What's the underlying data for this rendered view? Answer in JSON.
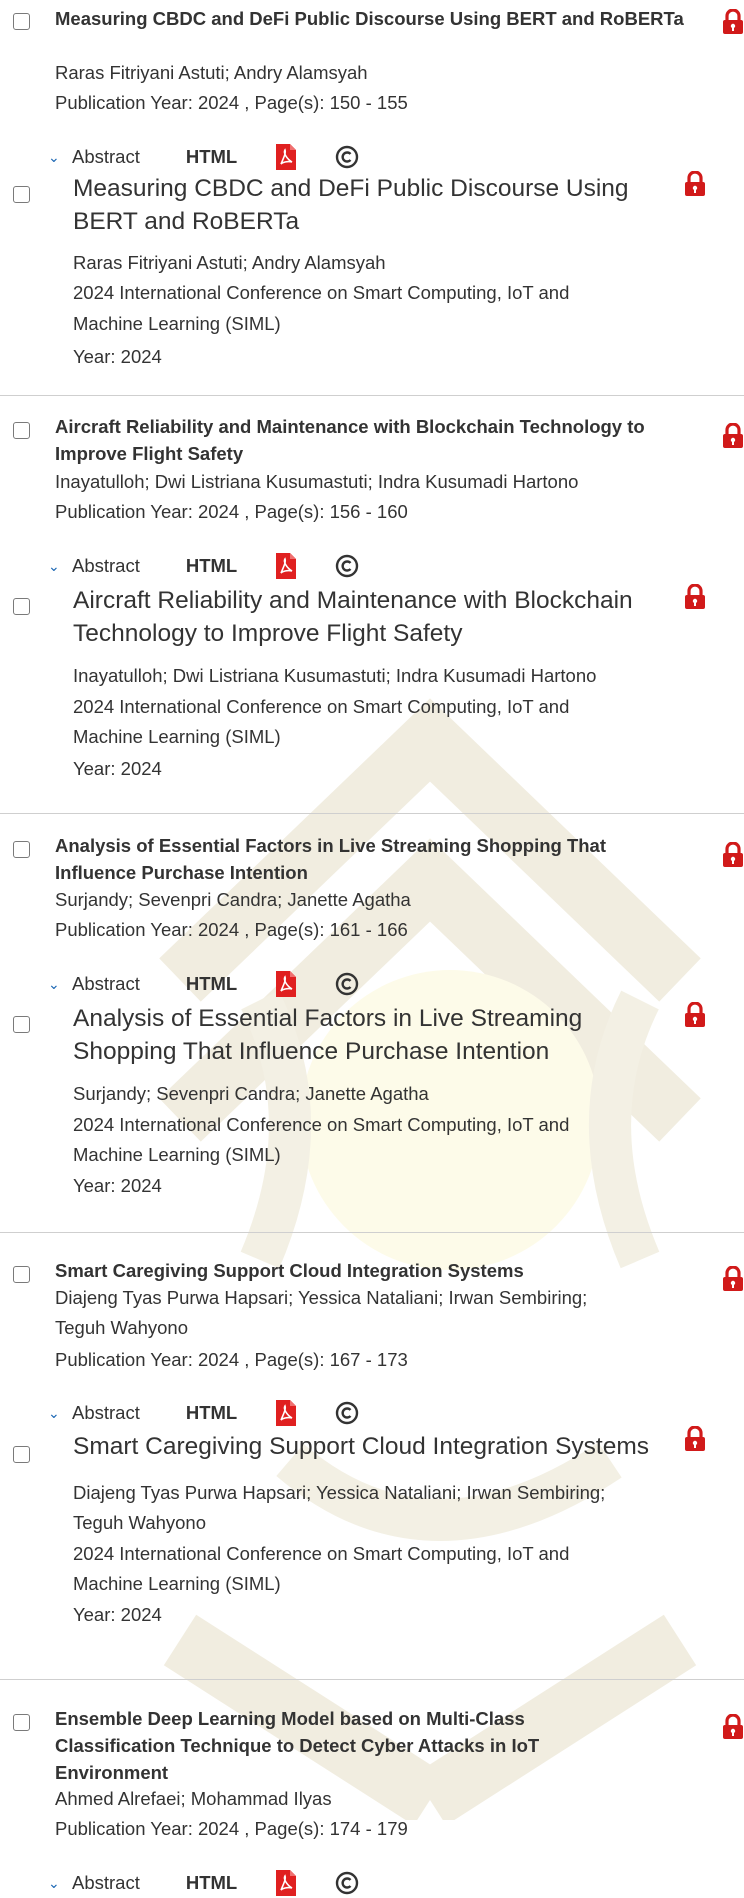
{
  "colors": {
    "lock": "#d11a1a",
    "pdf": "#e02020",
    "link": "#1a66b3",
    "divider": "#cfcfcf"
  },
  "icons": {
    "lock": "lock-icon",
    "pdf": "pdf-icon",
    "copyright": "copyright-icon",
    "chevron": "chevron-down-icon"
  },
  "labels": {
    "abstract": "Abstract",
    "html": "HTML"
  },
  "items": [
    {
      "header": {
        "title": "Measuring CBDC and DeFi Public Discourse Using BERT and RoBERTa",
        "authors": "Raras Fitriyani Astuti; Andry Alamsyah",
        "pubinfo": "Publication Year: 2024 , Page(s): 150  -  155"
      },
      "detail": {
        "title": "Measuring CBDC and DeFi Public Discourse Using BERT and RoBERTa",
        "authors": "Raras Fitriyani Astuti; Andry Alamsyah",
        "conf1": "2024 International Conference on Smart Computing, IoT and",
        "conf2": "Machine Learning (SIML)",
        "year": "Year: 2024"
      }
    },
    {
      "header": {
        "title": "Aircraft Reliability and Maintenance with Blockchain Technology to Improve Flight Safety",
        "authors": "Inayatulloh; Dwi Listriana Kusumastuti; Indra Kusumadi Hartono",
        "pubinfo": "Publication Year: 2024 , Page(s): 156  -  160"
      },
      "detail": {
        "title": "Aircraft Reliability and Maintenance with Blockchain Technology to Improve Flight Safety",
        "authors": "Inayatulloh; Dwi Listriana Kusumastuti; Indra Kusumadi Hartono",
        "conf1": "2024 International Conference on Smart Computing, IoT and",
        "conf2": "Machine Learning (SIML)",
        "year": "Year: 2024"
      }
    },
    {
      "header": {
        "title": "Analysis of Essential Factors in Live Streaming Shopping That Influence Purchase Intention",
        "authors": "Surjandy; Sevenpri Candra; Janette Agatha",
        "pubinfo": "Publication Year: 2024 , Page(s): 161  -  166"
      },
      "detail": {
        "title": "Analysis of Essential Factors in Live Streaming Shopping That Influence Purchase Intention",
        "authors": "Surjandy; Sevenpri Candra; Janette Agatha",
        "conf1": "2024 International Conference on Smart Computing, IoT and",
        "conf2": "Machine Learning (SIML)",
        "year": "Year: 2024"
      }
    },
    {
      "header": {
        "title": "Smart Caregiving Support Cloud Integration Systems",
        "authors1": "Diajeng Tyas Purwa Hapsari; Yessica Nataliani; Irwan Sembiring;",
        "authors2": "Teguh Wahyono",
        "pubinfo": "Publication Year: 2024 , Page(s): 167  -  173"
      },
      "detail": {
        "title": "Smart Caregiving Support Cloud Integration Systems",
        "authors1": "Diajeng Tyas Purwa Hapsari; Yessica Nataliani; Irwan Sembiring;",
        "authors2": "Teguh Wahyono",
        "conf1": "2024 International Conference on Smart Computing, IoT and",
        "conf2": "Machine Learning (SIML)",
        "year": "Year: 2024"
      }
    },
    {
      "header": {
        "title": "Ensemble Deep Learning Model based on Multi-Class Classification Technique to Detect Cyber Attacks in IoT Environment",
        "authors": "Ahmed Alrefaei; Mohammad Ilyas",
        "pubinfo": "Publication Year: 2024 , Page(s): 174  -  179"
      }
    }
  ]
}
